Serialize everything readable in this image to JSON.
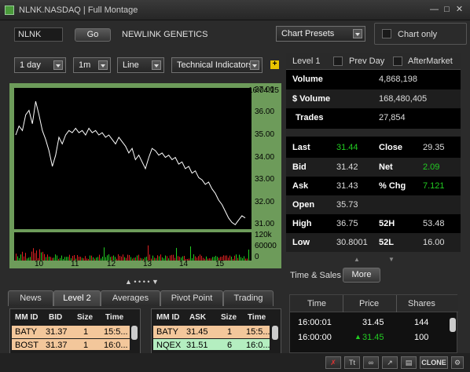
{
  "window": {
    "title": "NLNK.NASDAQ | Full Montage"
  },
  "toolbar": {
    "symbol_value": "NLNK",
    "go_label": "Go",
    "company_name": "NEWLINK GENETICS",
    "chart_presets_label": "Chart Presets",
    "chart_only_label": "Chart only"
  },
  "chart_controls": {
    "period": "1 day",
    "interval": "1m",
    "style": "Line",
    "indicators": "Technical Indicators"
  },
  "chart_data": {
    "type": "line",
    "time_badge": "16:04:15",
    "x_ticks": [
      "10",
      "11",
      "12",
      "13",
      "14",
      "15"
    ],
    "y_ticks": [
      "37.00",
      "36.00",
      "35.00",
      "34.00",
      "33.00",
      "32.00",
      "31.00"
    ],
    "ylim": [
      30.8,
      37.1
    ],
    "volume_ticks": [
      "120k",
      "60000",
      "0"
    ],
    "price_series": [
      35.0,
      35.4,
      35.2,
      35.9,
      36.1,
      35.5,
      36.5,
      35.9,
      35.2,
      34.8,
      34.3,
      33.6,
      34.1,
      34.9,
      34.6,
      35.0,
      35.2,
      35.1,
      35.3,
      35.1,
      35.2,
      35.0,
      35.3,
      35.1,
      35.2,
      35.0,
      35.1,
      34.9,
      35.0,
      34.8,
      34.6,
      34.9,
      34.7,
      34.5,
      34.2,
      34.4,
      33.9,
      34.1,
      33.8,
      33.5,
      34.0,
      34.4,
      34.3,
      34.1,
      34.2,
      34.0,
      34.1,
      33.9,
      34.0,
      33.7,
      33.8,
      33.5,
      33.6,
      33.3,
      33.4,
      33.1,
      33.0,
      32.8,
      32.9,
      32.6,
      32.4,
      32.1,
      31.9,
      31.6,
      31.3,
      31.1,
      31.0,
      31.2,
      31.4,
      31.3
    ]
  },
  "quote": {
    "level_label": "Level 1",
    "prev_day_label": "Prev Day",
    "after_market_label": "AfterMarket",
    "volume_label": "Volume",
    "volume_value": "4,868,198",
    "dollar_volume_label": "$ Volume",
    "dollar_volume_value": "168,480,405",
    "trades_label": "Trades",
    "trades_value": "27,854",
    "last_label": "Last",
    "last_value": "31.44",
    "close_label": "Close",
    "close_value": "29.35",
    "bid_label": "Bid",
    "bid_value": "31.42",
    "net_label": "Net",
    "net_value": "2.09",
    "ask_label": "Ask",
    "ask_value": "31.43",
    "pct_chg_label": "% Chg",
    "pct_chg_value": "7.121",
    "open_label": "Open",
    "open_value": "35.73",
    "high_label": "High",
    "high_value": "36.75",
    "h52_label": "52H",
    "h52_value": "53.48",
    "low_label": "Low",
    "low_value": "30.8001",
    "l52_label": "52L",
    "l52_value": "16.00"
  },
  "tabs": {
    "news": "News",
    "level2": "Level 2",
    "averages": "Averages",
    "pivot": "Pivot Point",
    "trading": "Trading"
  },
  "bid_book": {
    "headers": {
      "mm": "MM ID",
      "price": "BID",
      "size": "Size",
      "time": "Time"
    },
    "rows": [
      {
        "mm": "BATY",
        "price": "31.37",
        "size": "1",
        "time": "15:5..."
      },
      {
        "mm": "BOST",
        "price": "31.37",
        "size": "1",
        "time": "16:0..."
      }
    ]
  },
  "ask_book": {
    "headers": {
      "mm": "MM ID",
      "price": "ASK",
      "size": "Size",
      "time": "Time"
    },
    "rows": [
      {
        "mm": "BATY",
        "price": "31.45",
        "size": "1",
        "time": "15:5..."
      },
      {
        "mm": "NQEX",
        "price": "31.51",
        "size": "6",
        "time": "16:0..."
      }
    ]
  },
  "time_sales": {
    "label": "Time & Sales",
    "more_label": "More",
    "headers": {
      "time": "Time",
      "price": "Price",
      "shares": "Shares"
    },
    "rows": [
      {
        "time": "16:00:01",
        "price": "31.45",
        "shares": "144"
      },
      {
        "time": "16:00:00",
        "price": "31.45",
        "shares": "100"
      }
    ]
  },
  "bottom_bar": {
    "clone_label": "CLONE"
  },
  "colors": {
    "bid_row": "#f3c79b",
    "ask_row": "#f3c79b",
    "ask_row2": "#b4eec0",
    "chart_frame": "#6d9b5a",
    "up": "#22cc22"
  }
}
